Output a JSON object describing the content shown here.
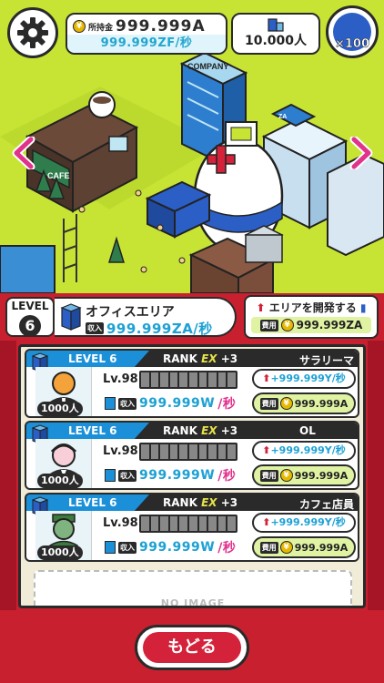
{
  "hud": {
    "money_label": "所持金",
    "money_value": "999.999A",
    "money_rate": "999.999ZF/秒",
    "population": "10.000人",
    "tickets": "×100"
  },
  "scene": {
    "company_sign": "COMPANY",
    "cafe_sign": "CAFE",
    "za_sign": "ZA"
  },
  "area": {
    "level_label": "LEVEL",
    "level_value": "6",
    "name": "オフィスエリア",
    "income_tag": "収入",
    "income_value": "999.999ZA/秒",
    "develop_label": "エリアを開発する",
    "cost_tag": "費用",
    "cost_value": "999.999ZA"
  },
  "staff": [
    {
      "level": "LEVEL 6",
      "rank": "RANK",
      "ex": "EX",
      "plus": "+3",
      "job": "サラリーマン",
      "count": "1000人",
      "lv": "Lv.98",
      "income_tag": "収入",
      "income_value": "999.999W",
      "income_unit": "/秒",
      "rate": "+999.999Y/秒",
      "cost_tag": "費用",
      "cost_value": "999.999A",
      "gauge_filled": 0
    },
    {
      "level": "LEVEL 6",
      "rank": "RANK",
      "ex": "EX",
      "plus": "+3",
      "job": "OL",
      "count": "1000人",
      "lv": "Lv.98",
      "income_tag": "収入",
      "income_value": "999.999W",
      "income_unit": "/秒",
      "rate": "+999.999Y/秒",
      "cost_tag": "費用",
      "cost_value": "999.999A",
      "gauge_filled": 0
    },
    {
      "level": "LEVEL 6",
      "rank": "RANK",
      "ex": "EX",
      "plus": "+3",
      "job": "カフェ店員",
      "count": "1000人",
      "lv": "Lv.98",
      "income_tag": "収入",
      "income_value": "999.999W",
      "income_unit": "/秒",
      "rate": "+999.999Y/秒",
      "cost_tag": "費用",
      "cost_value": "999.999A",
      "gauge_filled": 0
    }
  ],
  "noimage": "NO IMAGE",
  "back_label": "もどる",
  "colors": {
    "accent_red": "#c9202f",
    "field_green": "#c7e435",
    "value_blue": "#1da1d4",
    "cost_green": "#dff3a3"
  }
}
